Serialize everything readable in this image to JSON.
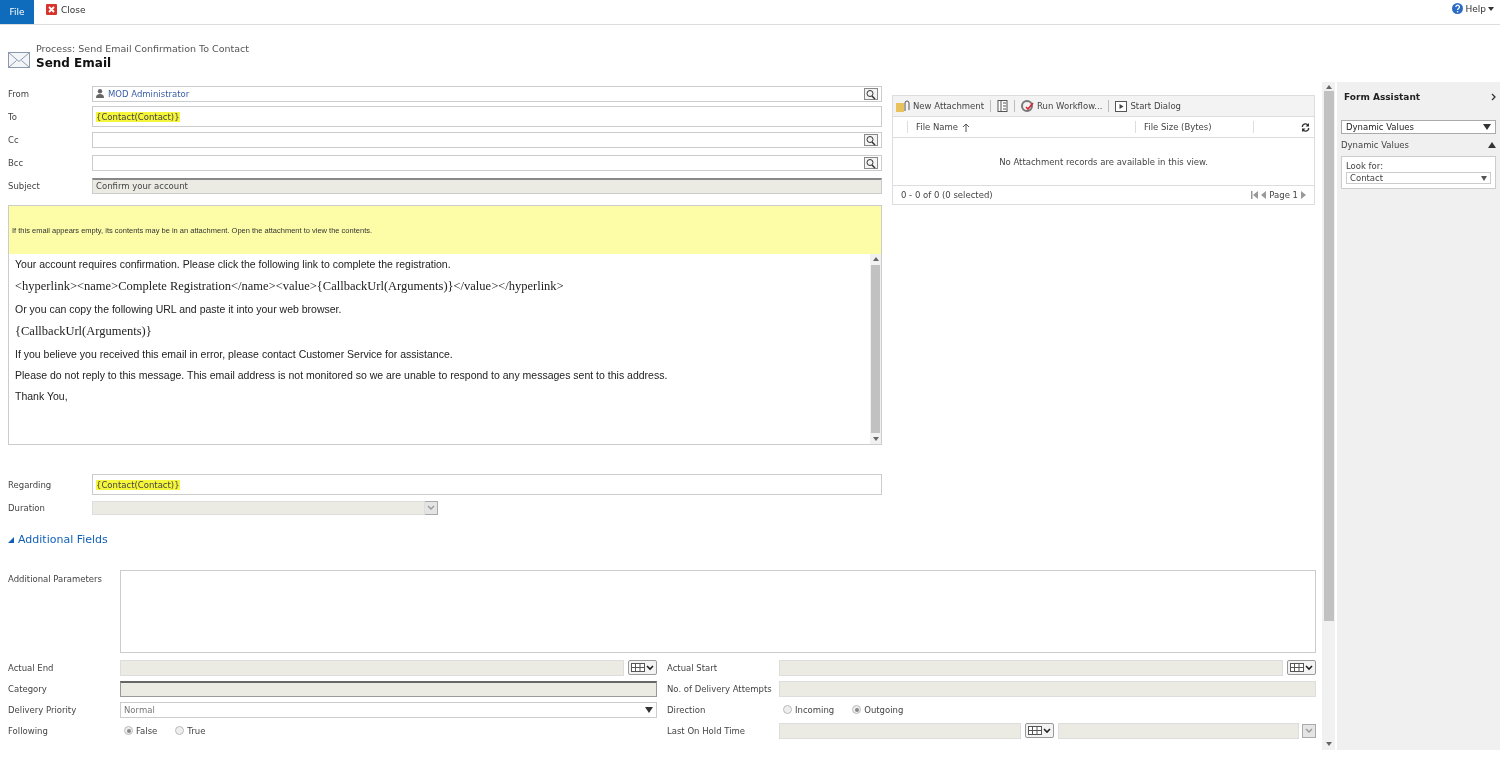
{
  "ribbon": {
    "file_tab": "File",
    "close": "Close",
    "help": "Help"
  },
  "header": {
    "process": "Process: Send Email Confirmation To Contact",
    "title": "Send Email"
  },
  "fields": [
    {
      "label": "From",
      "kind": "lookup",
      "value": "MOD Administrator"
    },
    {
      "label": "To",
      "kind": "text",
      "value": "{Contact(Contact)}",
      "highlighted": true
    },
    {
      "label": "Cc",
      "kind": "lookup"
    },
    {
      "label": "Bcc",
      "kind": "lookup"
    },
    {
      "label": "Subject",
      "kind": "readonly",
      "value": "Confirm your account"
    }
  ],
  "notice": "If this email appears empty, its contents may be in an attachment. Open the attachment to view the contents.",
  "body": [
    {
      "kind": "sans",
      "text": "Your account requires confirmation. Please click the following link to complete the registration."
    },
    {
      "kind": "serif",
      "text": "<hyperlink><name>Complete Registration</name><value>{CallbackUrl(Arguments)}</value></hyperlink>"
    },
    {
      "kind": "sans",
      "text": "Or you can copy the following URL and paste it into your web browser."
    },
    {
      "kind": "serif",
      "text": "{CallbackUrl(Arguments)}"
    },
    {
      "kind": "sans",
      "text": "If you believe you received this email in error, please contact Customer Service for assistance."
    },
    {
      "kind": "sans",
      "text": "Please do not reply to this message. This email address is not monitored so we are unable to respond to any messages sent to this address."
    },
    {
      "kind": "sans",
      "text": "Thank You,"
    }
  ],
  "regarding": {
    "label": "Regarding",
    "value": "{Contact(Contact)}",
    "highlighted": true
  },
  "duration": {
    "label": "Duration"
  },
  "additional_fields": {
    "label": "Additional Fields",
    "expanded": true
  },
  "additional_parameters": {
    "label": "Additional Parameters"
  },
  "bottom_fields": [
    {
      "label": "Actual End",
      "kind": "date"
    },
    {
      "label": "Actual Start",
      "kind": "date"
    },
    {
      "label": "Category",
      "kind": "text"
    },
    {
      "label": "No. of Delivery Attempts",
      "kind": "readonly"
    },
    {
      "label": "Delivery Priority",
      "kind": "select",
      "value": "Normal"
    },
    {
      "label": "Direction",
      "kind": "radio",
      "options": [
        {
          "label": "Incoming",
          "selected": false
        },
        {
          "label": "Outgoing",
          "selected": true
        }
      ]
    },
    {
      "label": "Following",
      "kind": "radio",
      "options": [
        {
          "label": "False",
          "selected": true
        },
        {
          "label": "True",
          "selected": false
        }
      ]
    },
    {
      "label": "Last On Hold Time",
      "kind": "datetime"
    }
  ],
  "attachments": {
    "toolbar": [
      {
        "kind": "attach",
        "label": "New Attachment"
      },
      {
        "kind": "book"
      },
      {
        "kind": "workflow",
        "label": "Run Workflow..."
      },
      {
        "kind": "dialog",
        "label": "Start Dialog"
      }
    ],
    "columns": [
      {
        "label": "File Name",
        "sorted": true
      },
      {
        "label": "File Size (Bytes)",
        "sorted": false
      }
    ],
    "empty": "No Attachment records are available in this view.",
    "count": "0 - 0 of 0 (0 selected)",
    "page": "Page 1"
  },
  "form_assistant": {
    "title": "Form Assistant",
    "dropdown": "Dynamic Values",
    "section": "Dynamic Values",
    "expanded": true,
    "look_for_label": "Look for:",
    "look_for": "Contact"
  }
}
